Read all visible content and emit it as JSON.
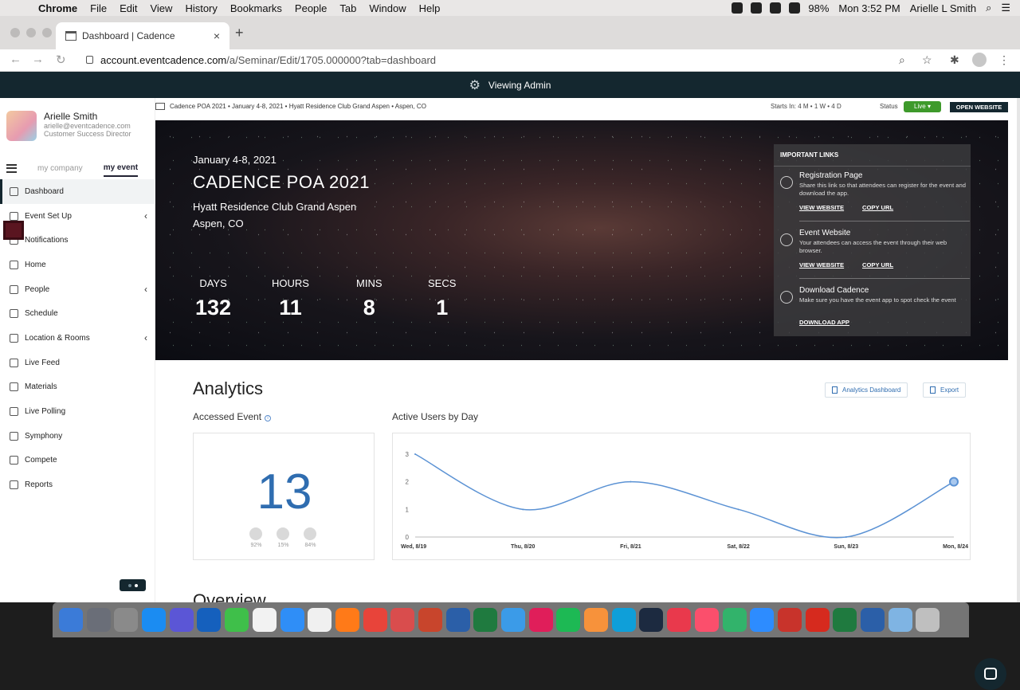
{
  "menubar": {
    "app": "Chrome",
    "items": [
      "File",
      "Edit",
      "View",
      "History",
      "Bookmarks",
      "People",
      "Tab",
      "Window",
      "Help"
    ],
    "battery": "98%",
    "clock": "Mon 3:52 PM",
    "user": "Arielle L Smith"
  },
  "browser": {
    "tab_title": "Dashboard | Cadence",
    "url_host": "account.eventcadence.com",
    "url_path": "/a/Seminar/Edit/1705.000000?tab=dashboard"
  },
  "admin_bar": {
    "label": "Viewing Admin"
  },
  "user": {
    "name": "Arielle Smith",
    "email": "arielle@eventcadence.com",
    "role": "Customer Success Director"
  },
  "sidebar": {
    "tab_company": "my company",
    "tab_event": "my event",
    "items": [
      {
        "label": "Dashboard"
      },
      {
        "label": "Event Set Up"
      },
      {
        "label": "Notifications"
      },
      {
        "label": "Home"
      },
      {
        "label": "People"
      },
      {
        "label": "Schedule"
      },
      {
        "label": "Location & Rooms"
      },
      {
        "label": "Live Feed"
      },
      {
        "label": "Materials"
      },
      {
        "label": "Live Polling"
      },
      {
        "label": "Symphony"
      },
      {
        "label": "Compete"
      },
      {
        "label": "Reports"
      }
    ]
  },
  "header": {
    "breadcrumb": "Cadence POA 2021 • January 4-8, 2021 • Hyatt Residence Club Grand Aspen • Aspen, CO",
    "starts_in": "Starts In: 4 M  •  1 W  •  4 D",
    "status_label": "Status",
    "status_value": "Live",
    "open_website": "OPEN WEBSITE"
  },
  "event": {
    "dates": "January 4-8, 2021",
    "name": "CADENCE POA 2021",
    "venue": "Hyatt Residence Club Grand Aspen",
    "location": "Aspen, CO"
  },
  "countdown": {
    "days_label": "DAYS",
    "days": "132",
    "hours_label": "HOURS",
    "hours": "11",
    "mins_label": "MINS",
    "mins": "8",
    "secs_label": "SECS",
    "secs": "1"
  },
  "important_links": {
    "title": "IMPORTANT LINKS",
    "registration": {
      "title": "Registration Page",
      "desc": "Share this link so that attendees can register for the event and download the app.",
      "view": "VIEW WEBSITE",
      "copy": "COPY URL"
    },
    "website": {
      "title": "Event Website",
      "desc": "Your attendees can access the event through their web browser.",
      "view": "VIEW WEBSITE",
      "copy": "COPY URL"
    },
    "download": {
      "title": "Download Cadence",
      "desc": "Make sure you have the event app to spot check the event",
      "action": "DOWNLOAD APP"
    }
  },
  "analytics": {
    "title": "Analytics",
    "dashboard_button": "Analytics Dashboard",
    "export_button": "Export",
    "accessed_label": "Accessed Event",
    "accessed_value": "13",
    "ios_pct": "92%",
    "android_pct": "15%",
    "web_pct": "84%",
    "active_label": "Active Users by Day"
  },
  "overview": {
    "title": "Overview"
  },
  "chart_data": {
    "type": "line",
    "title": "Active Users by Day",
    "categories": [
      "Wed, 8/19",
      "Thu, 8/20",
      "Fri, 8/21",
      "Sat, 8/22",
      "Sun, 8/23",
      "Mon, 8/24"
    ],
    "series": [
      {
        "values": [
          3,
          1,
          2,
          1,
          0,
          2
        ]
      }
    ],
    "yticks": [
      0,
      1,
      2,
      3
    ],
    "ylim": [
      0,
      3
    ],
    "color": "#5b92d4"
  },
  "colors": {
    "navy": "#14272f",
    "accent": "#2f6db0",
    "live": "#3e9a2b"
  }
}
